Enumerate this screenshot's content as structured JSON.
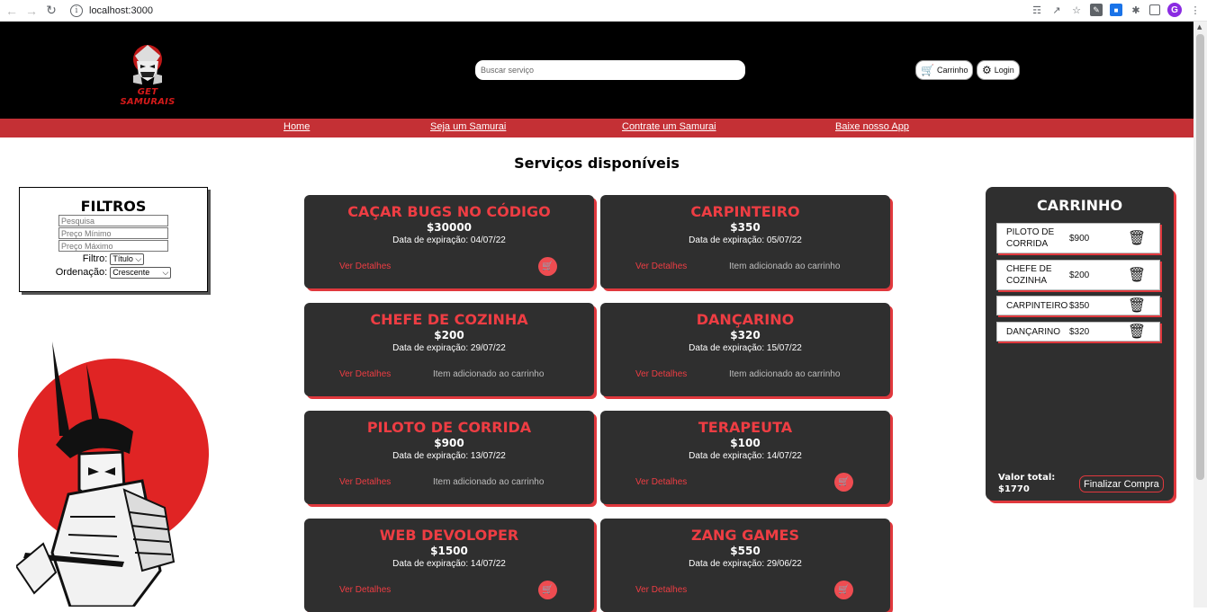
{
  "browser": {
    "url": "localhost:3000",
    "back_icon": "arrow-left",
    "forward_icon": "arrow-right",
    "reload_icon": "reload",
    "avatar_letter": "G"
  },
  "header": {
    "logo_text": "GET SAMURAIS",
    "search_placeholder": "Buscar serviço",
    "cart_label": "Carrinho",
    "login_label": "Login"
  },
  "nav": {
    "items": [
      "Home",
      "Seja um Samurai",
      "Contrate um Samurai",
      "Baixe nosso App"
    ]
  },
  "main": {
    "title": "Serviços disponíveis"
  },
  "filters": {
    "title": "FILTROS",
    "search_placeholder": "Pesquisa",
    "min_price_placeholder": "Preço Mínimo",
    "max_price_placeholder": "Preço Máximo",
    "filter_label": "Filtro:",
    "filter_value": "Título",
    "sort_label": "Ordenação:",
    "sort_value": "Crescente"
  },
  "services": [
    {
      "title": "CAÇAR BUGS NO CÓDIGO",
      "price": "$30000",
      "date": "Data de expiração: 04/07/22",
      "details": "Ver Detalhes",
      "in_cart": false
    },
    {
      "title": "CARPINTEIRO",
      "price": "$350",
      "date": "Data de expiração: 05/07/22",
      "details": "Ver Detalhes",
      "in_cart": true
    },
    {
      "title": "CHEFE DE COZINHA",
      "price": "$200",
      "date": "Data de expiração: 29/07/22",
      "details": "Ver Detalhes",
      "in_cart": true
    },
    {
      "title": "DANÇARINO",
      "price": "$320",
      "date": "Data de expiração: 15/07/22",
      "details": "Ver Detalhes",
      "in_cart": true
    },
    {
      "title": "PILOTO DE CORRIDA",
      "price": "$900",
      "date": "Data de expiração: 13/07/22",
      "details": "Ver Detalhes",
      "in_cart": true
    },
    {
      "title": "TERAPEUTA",
      "price": "$100",
      "date": "Data de expiração: 14/07/22",
      "details": "Ver Detalhes",
      "in_cart": false
    },
    {
      "title": "WEB DEVOLOPER",
      "price": "$1500",
      "date": "Data de expiração: 14/07/22",
      "details": "Ver Detalhes",
      "in_cart": false
    },
    {
      "title": "ZANG GAMES",
      "price": "$550",
      "date": "Data de expiração: 29/06/22",
      "details": "Ver Detalhes",
      "in_cart": false
    }
  ],
  "added_text": "Item adicionado ao carrinho",
  "cart": {
    "title": "CARRINHO",
    "items": [
      {
        "name": "PILOTO DE CORRIDA",
        "price": "$900"
      },
      {
        "name": "CHEFE DE COZINHA",
        "price": "$200"
      },
      {
        "name": "CARPINTEIRO",
        "price": "$350"
      },
      {
        "name": "DANÇARINO",
        "price": "$320"
      }
    ],
    "total_label": "Valor total:",
    "total_value": "$1770",
    "checkout_label": "Finalizar Compra"
  },
  "colors": {
    "accent": "#ee3d43",
    "header_bg": "#000000",
    "navbar_bg": "#c43035",
    "card_bg": "#2f2f2f"
  }
}
